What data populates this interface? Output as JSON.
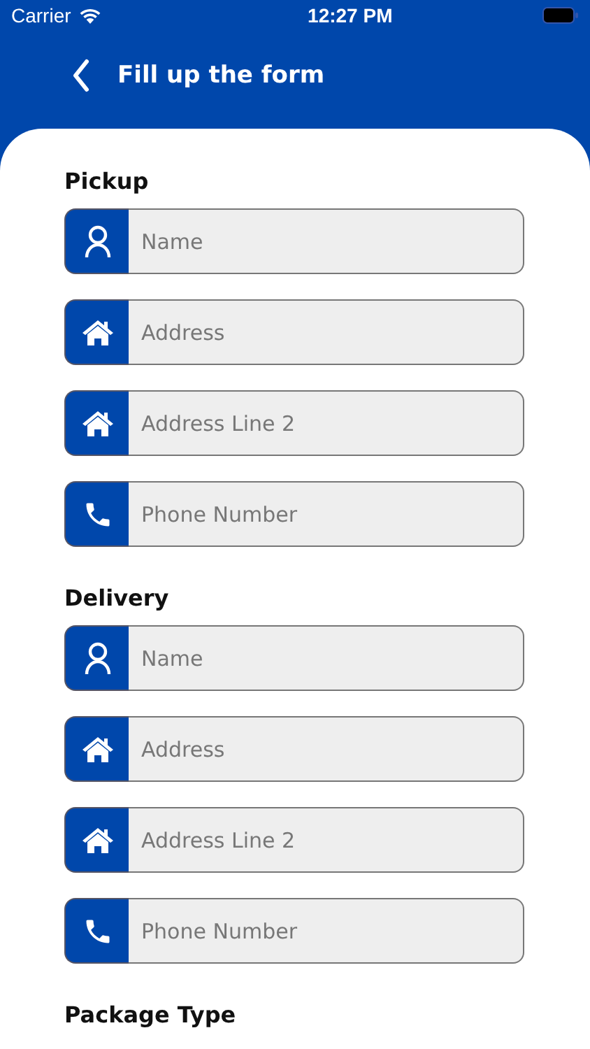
{
  "status_bar": {
    "carrier": "Carrier",
    "time": "12:27 PM"
  },
  "header": {
    "title": "Fill up the form"
  },
  "sections": [
    {
      "title": "Pickup",
      "fields": [
        {
          "kind": "person",
          "placeholder": "Name"
        },
        {
          "kind": "home",
          "placeholder": "Address"
        },
        {
          "kind": "home",
          "placeholder": "Address Line 2"
        },
        {
          "kind": "phone",
          "placeholder": "Phone Number"
        }
      ]
    },
    {
      "title": "Delivery",
      "fields": [
        {
          "kind": "person",
          "placeholder": "Name"
        },
        {
          "kind": "home",
          "placeholder": "Address"
        },
        {
          "kind": "home",
          "placeholder": "Address Line 2"
        },
        {
          "kind": "phone",
          "placeholder": "Phone Number"
        }
      ]
    },
    {
      "title": "Package Type"
    }
  ]
}
